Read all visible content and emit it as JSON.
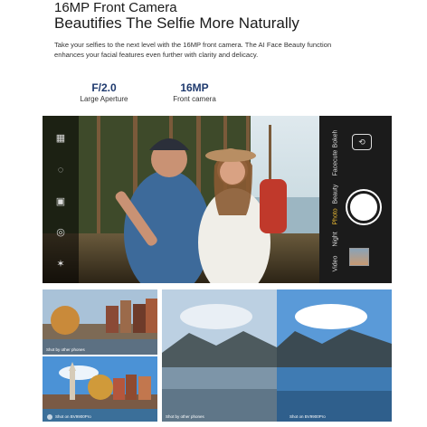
{
  "header": {
    "title_line1": "16MP Front Camera",
    "title_line2": "Beautifies The Selfie More Naturally",
    "description": "Take your selfies to the next level with the 16MP front camera. The AI Face Beauty function enhances your facial features even further with clarity and delicacy."
  },
  "specs": [
    {
      "value": "F/2.0",
      "label": "Large Aperture"
    },
    {
      "value": "16MP",
      "label": "Front camera"
    }
  ],
  "camera_ui": {
    "left_icons": [
      "grid-icon",
      "chat-icon",
      "settings-icon",
      "filter-icon",
      "flash-icon"
    ],
    "modes": [
      "Video",
      "Night",
      "Photo",
      "Beauty",
      "Facecute",
      "Bokeh"
    ],
    "active_mode": "Photo",
    "accent_color": "#f2c036"
  },
  "comparisons": {
    "left_top_caption": "Shot by other phones",
    "left_bottom_caption": "Shot on BV9900Pro",
    "right_left_caption": "Shot by other phones",
    "right_right_caption": "Shot on BV9900Pro"
  }
}
